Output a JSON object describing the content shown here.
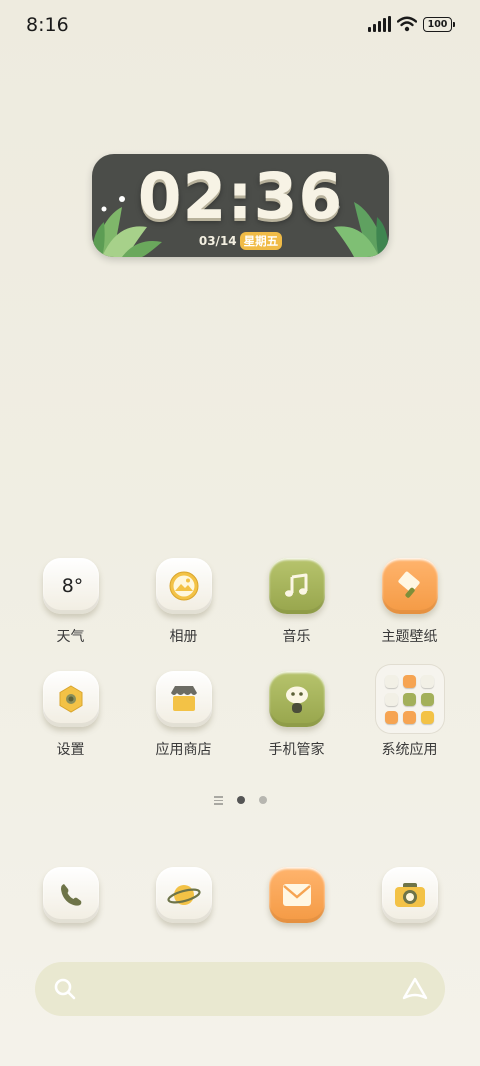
{
  "status_bar": {
    "time": "8:16",
    "battery": "100"
  },
  "clock_widget": {
    "time": "02:36",
    "date": "03/14",
    "weekday": "星期五"
  },
  "apps_row1": [
    {
      "label": "天气",
      "value": "8°",
      "icon": "weather-icon"
    },
    {
      "label": "相册",
      "icon": "gallery-icon"
    },
    {
      "label": "音乐",
      "icon": "music-icon"
    },
    {
      "label": "主题壁纸",
      "icon": "theme-brush-icon"
    }
  ],
  "apps_row2": [
    {
      "label": "设置",
      "icon": "settings-gear-icon"
    },
    {
      "label": "应用商店",
      "icon": "app-store-icon"
    },
    {
      "label": "手机管家",
      "icon": "phone-manager-icon"
    },
    {
      "label": "系统应用",
      "icon": "system-apps-folder"
    }
  ],
  "page_indicator": {
    "pages": 2,
    "active": 1
  },
  "dock": [
    {
      "icon": "phone-icon"
    },
    {
      "icon": "browser-planet-icon"
    },
    {
      "icon": "messages-envelope-icon"
    },
    {
      "icon": "camera-icon"
    }
  ],
  "search_bar": {
    "icon": "search-icon",
    "brand_icon": "assistant-icon"
  },
  "colors": {
    "accent_green": "#a3b05a",
    "accent_orange": "#f6a452",
    "accent_yellow": "#f0c040",
    "widget_bg": "#4b4d49"
  }
}
